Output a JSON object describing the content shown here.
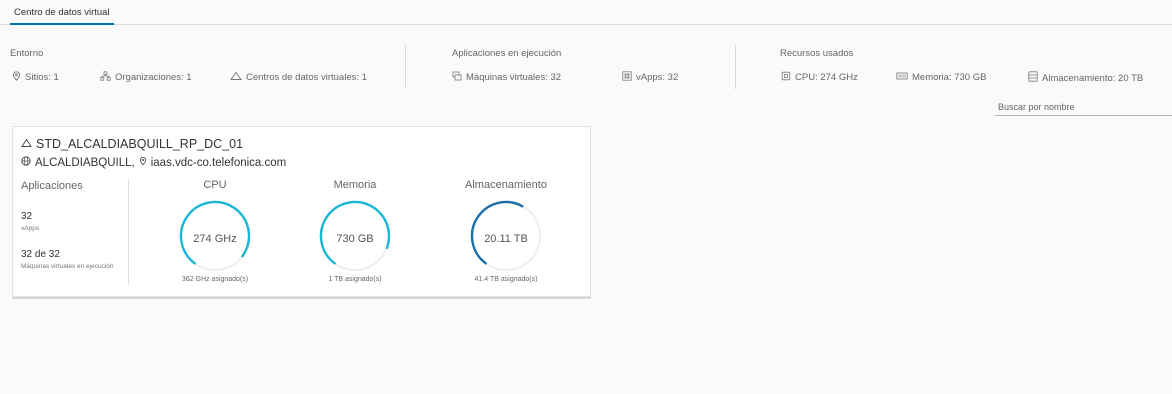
{
  "tabs": [
    {
      "label": "Centro de datos virtual"
    }
  ],
  "summary": {
    "entorno": {
      "title": "Entorno",
      "items": [
        {
          "label": "Sitios: 1",
          "icon": "location-pin-icon"
        },
        {
          "label": "Organizaciones: 1",
          "icon": "organization-icon"
        },
        {
          "label": "Centros de datos virtuales: 1",
          "icon": "cloud-icon"
        }
      ]
    },
    "apps": {
      "title": "Aplicaciones en ejecución",
      "items": [
        {
          "label": "Máquinas virtuales: 32",
          "icon": "vm-icon"
        },
        {
          "label": "vApps: 32",
          "icon": "vapp-icon"
        }
      ]
    },
    "recursos": {
      "title": "Recursos usados",
      "items": [
        {
          "label": "CPU: 274 GHz",
          "icon": "cpu-icon"
        },
        {
          "label": "Memoria: 730 GB",
          "icon": "memory-icon"
        },
        {
          "label": "Almacenamiento: 20 TB",
          "icon": "storage-icon"
        }
      ]
    }
  },
  "search": {
    "placeholder": "Buscar por nombre"
  },
  "card": {
    "title": "STD_ALCALDIABQUILL_RP_DC_01",
    "org": "ALCALDIABQUILL,",
    "site": "iaas.vdc-co.telefonica.com",
    "apps_label": "Aplicaciones",
    "vapps_count": "32",
    "vapps_label": "vApps",
    "vms_count": "32 de 32",
    "vms_label": "Máquinas virtuales en ejecución",
    "gauges": [
      {
        "title": "CPU",
        "value": "274 GHz",
        "footer": "362 GHz asignado(s)",
        "fraction": 0.757,
        "color": "#1ab6d4"
      },
      {
        "title": "Memoria",
        "value": "730 GB",
        "footer": "1 TB asignado(s)",
        "fraction": 0.713,
        "color": "#1ab6d4"
      },
      {
        "title": "Almacenamiento",
        "value": "20.11 TB",
        "footer": "41.4 TB asignado(s)",
        "fraction": 0.486,
        "color": "#1a6fa8"
      }
    ]
  }
}
